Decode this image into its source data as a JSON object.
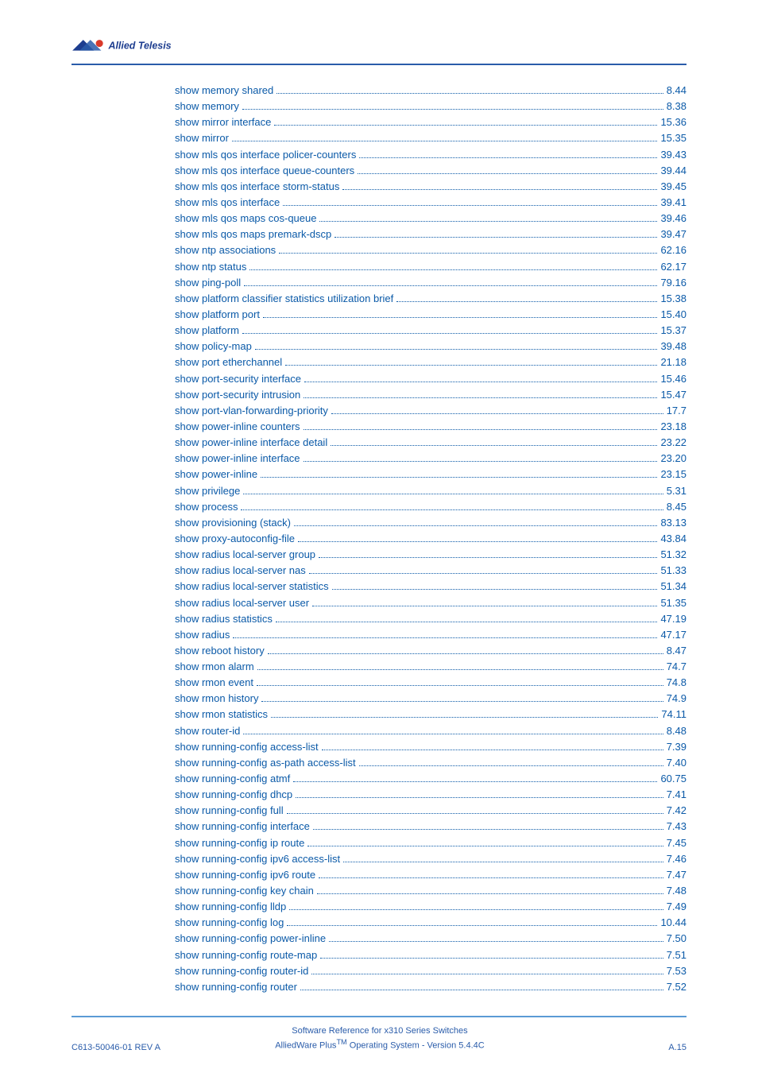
{
  "logo_text": "Allied Telesis",
  "toc": [
    {
      "label": "show memory shared",
      "page": "8.44"
    },
    {
      "label": "show memory",
      "page": "8.38"
    },
    {
      "label": "show mirror interface",
      "page": "15.36"
    },
    {
      "label": "show mirror",
      "page": "15.35"
    },
    {
      "label": "show mls qos interface policer-counters",
      "page": "39.43"
    },
    {
      "label": "show mls qos interface queue-counters",
      "page": "39.44"
    },
    {
      "label": "show mls qos interface storm-status",
      "page": "39.45"
    },
    {
      "label": "show mls qos interface",
      "page": "39.41"
    },
    {
      "label": "show mls qos maps cos-queue",
      "page": "39.46"
    },
    {
      "label": "show mls qos maps premark-dscp",
      "page": "39.47"
    },
    {
      "label": "show ntp associations",
      "page": "62.16"
    },
    {
      "label": "show ntp status",
      "page": "62.17"
    },
    {
      "label": "show ping-poll",
      "page": "79.16"
    },
    {
      "label": "show platform classifier statistics utilization brief",
      "page": "15.38"
    },
    {
      "label": "show platform port",
      "page": "15.40"
    },
    {
      "label": "show platform",
      "page": "15.37"
    },
    {
      "label": "show policy-map",
      "page": "39.48"
    },
    {
      "label": "show port etherchannel",
      "page": "21.18"
    },
    {
      "label": "show port-security interface",
      "page": "15.46"
    },
    {
      "label": "show port-security intrusion",
      "page": "15.47"
    },
    {
      "label": "show port-vlan-forwarding-priority",
      "page": "17.7"
    },
    {
      "label": "show power-inline counters",
      "page": "23.18"
    },
    {
      "label": "show power-inline interface detail",
      "page": "23.22"
    },
    {
      "label": "show power-inline interface",
      "page": "23.20"
    },
    {
      "label": "show power-inline",
      "page": "23.15"
    },
    {
      "label": "show privilege",
      "page": "5.31"
    },
    {
      "label": "show process",
      "page": "8.45"
    },
    {
      "label": "show provisioning (stack)",
      "page": "83.13"
    },
    {
      "label": "show proxy-autoconfig-file",
      "page": "43.84"
    },
    {
      "label": "show radius local-server group",
      "page": "51.32"
    },
    {
      "label": "show radius local-server nas",
      "page": "51.33"
    },
    {
      "label": "show radius local-server statistics",
      "page": "51.34"
    },
    {
      "label": "show radius local-server user",
      "page": "51.35"
    },
    {
      "label": "show radius statistics",
      "page": "47.19"
    },
    {
      "label": "show radius",
      "page": "47.17"
    },
    {
      "label": "show reboot history",
      "page": "8.47"
    },
    {
      "label": "show rmon alarm",
      "page": "74.7"
    },
    {
      "label": "show rmon event",
      "page": "74.8"
    },
    {
      "label": "show rmon history",
      "page": "74.9"
    },
    {
      "label": "show rmon statistics",
      "page": "74.11"
    },
    {
      "label": "show router-id",
      "page": "8.48"
    },
    {
      "label": "show running-config access-list",
      "page": "7.39"
    },
    {
      "label": "show running-config as-path access-list",
      "page": "7.40"
    },
    {
      "label": "show running-config atmf",
      "page": "60.75"
    },
    {
      "label": "show running-config dhcp",
      "page": "7.41"
    },
    {
      "label": "show running-config full",
      "page": "7.42"
    },
    {
      "label": "show running-config interface",
      "page": "7.43"
    },
    {
      "label": "show running-config ip route",
      "page": "7.45"
    },
    {
      "label": "show running-config ipv6 access-list",
      "page": "7.46"
    },
    {
      "label": "show running-config ipv6 route",
      "page": "7.47"
    },
    {
      "label": "show running-config key chain",
      "page": "7.48"
    },
    {
      "label": "show running-config lldp",
      "page": "7.49"
    },
    {
      "label": "show running-config log",
      "page": "10.44"
    },
    {
      "label": "show running-config power-inline",
      "page": "7.50"
    },
    {
      "label": "show running-config route-map",
      "page": "7.51"
    },
    {
      "label": "show running-config router-id",
      "page": "7.53"
    },
    {
      "label": "show running-config router",
      "page": "7.52"
    }
  ],
  "footer": {
    "left": "C613-50046-01 REV A",
    "center_line1": "Software Reference for x310 Series Switches",
    "center_line2_prefix": "AlliedWare Plus",
    "center_line2_sup": "TM",
    "center_line2_suffix": " Operating System - Version 5.4.4C",
    "right": "A.15"
  }
}
